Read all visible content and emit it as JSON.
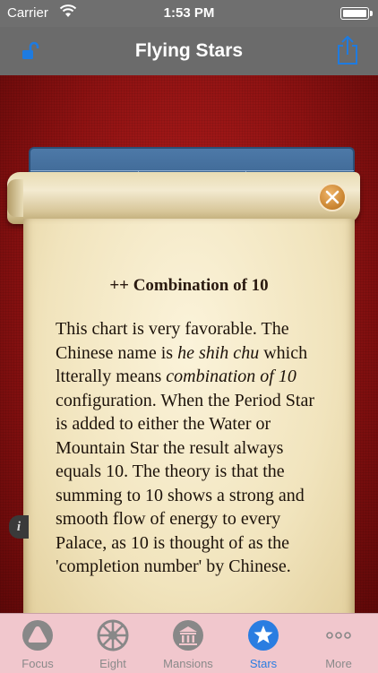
{
  "status_bar": {
    "carrier": "Carrier",
    "time": "1:53 PM"
  },
  "nav": {
    "title": "Flying Stars",
    "left_icon": "unlock-icon",
    "right_icon": "share-icon",
    "accent": "#1e7be0"
  },
  "card": {
    "heading": "++ Combination of 10",
    "paragraph": {
      "p1": "This chart is very favorable. The Chinese name is ",
      "italic1": "he shih chu",
      "p2": " which ltterally means ",
      "italic2": "combination of 10",
      "p3": " configuration. When the Period Star is added to either the Water or Mountain Star the result always equals 10. The theory is that the summing to 10 shows a strong and smooth flow of energy to every Palace, as 10 is thought of as the 'completion number' by Chinese."
    },
    "info_glyph": "i"
  },
  "tabs": [
    {
      "label": "Focus",
      "icon": "triangle-icon",
      "active": false
    },
    {
      "label": "Eight",
      "icon": "wheel-icon",
      "active": false
    },
    {
      "label": "Mansions",
      "icon": "temple-icon",
      "active": false
    },
    {
      "label": "Stars",
      "icon": "star-icon",
      "active": true
    },
    {
      "label": "More",
      "icon": "more-icon",
      "active": false
    }
  ],
  "colors": {
    "tab_active": "#2a7de1",
    "tab_inactive": "#8a8a8a",
    "tab_bar_bg": "#f1c7cd",
    "nav_bg": "#6b6b6b"
  }
}
